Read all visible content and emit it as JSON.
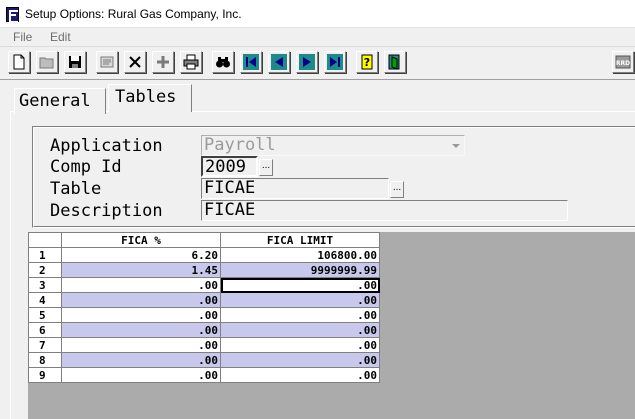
{
  "window": {
    "title": "Setup Options: Rural Gas Company, Inc."
  },
  "menu": {
    "items": [
      "File",
      "Edit"
    ]
  },
  "toolbar": {
    "buttons": [
      "new-icon",
      "open-icon",
      "save-icon",
      "edit-icon",
      "delete-icon",
      "add-icon",
      "print-icon",
      "find-icon",
      "first-record-icon",
      "previous-record-icon",
      "next-record-icon",
      "last-record-icon",
      "help-icon",
      "exit-icon",
      "logo-icon"
    ]
  },
  "tabs": [
    {
      "label": "General",
      "active": false
    },
    {
      "label": "Tables",
      "active": true
    }
  ],
  "form": {
    "application_label": "Application",
    "application_value": "Payroll",
    "comp_id_label": "Comp Id",
    "comp_id_value": "2009",
    "table_label": "Table",
    "table_value": "FICAE",
    "description_label": "Description",
    "description_value": "FICAE",
    "ellipsis": "..."
  },
  "grid": {
    "headers": [
      "FICA %",
      "FICA LIMIT"
    ],
    "rows": [
      {
        "num": "1",
        "fica_pct": "6.20",
        "fica_limit": "106800.00"
      },
      {
        "num": "2",
        "fica_pct": "1.45",
        "fica_limit": "9999999.99"
      },
      {
        "num": "3",
        "fica_pct": ".00",
        "fica_limit": ".00"
      },
      {
        "num": "4",
        "fica_pct": ".00",
        "fica_limit": ".00"
      },
      {
        "num": "5",
        "fica_pct": ".00",
        "fica_limit": ".00"
      },
      {
        "num": "6",
        "fica_pct": ".00",
        "fica_limit": ".00"
      },
      {
        "num": "7",
        "fica_pct": ".00",
        "fica_limit": ".00"
      },
      {
        "num": "8",
        "fica_pct": ".00",
        "fica_limit": ".00"
      },
      {
        "num": "9",
        "fica_pct": ".00",
        "fica_limit": ".00"
      }
    ],
    "selected_row": 3,
    "alt_row_color": "#c8c8ec"
  }
}
